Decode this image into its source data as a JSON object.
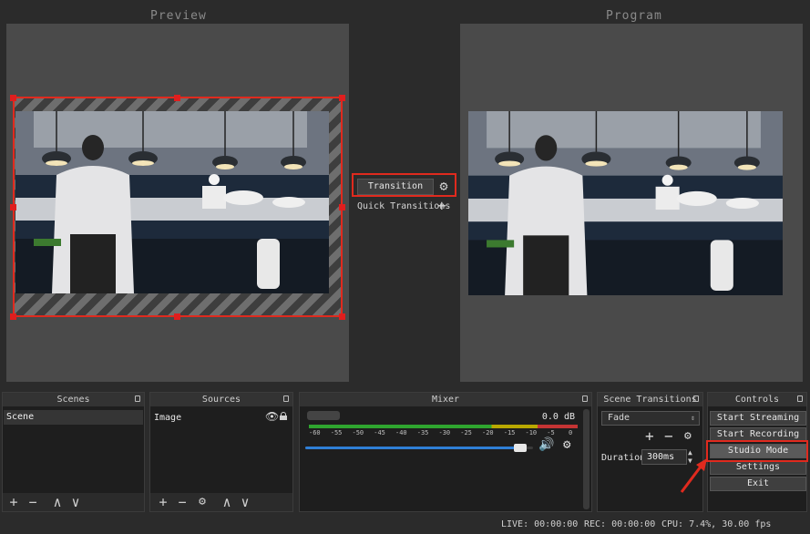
{
  "preview": {
    "title": "Preview"
  },
  "program": {
    "title": "Program"
  },
  "transition": {
    "button_label": "Transition",
    "quick_label": "Quick Transitions",
    "settings_icon": "gear-icon",
    "add_icon": "plus-icon"
  },
  "docks": {
    "scenes": {
      "title": "Scenes",
      "items": [
        "Scene"
      ]
    },
    "sources": {
      "title": "Sources",
      "items": [
        "Image"
      ]
    },
    "mixer": {
      "title": "Mixer",
      "db_value": "0.0 dB",
      "ticks": [
        "-60",
        "-55",
        "-50",
        "-45",
        "-40",
        "-35",
        "-30",
        "-25",
        "-20",
        "-15",
        "-10",
        "-5",
        "0"
      ],
      "volume_fraction": 0.97
    },
    "scene_transitions": {
      "title": "Scene Transitions",
      "selected": "Fade",
      "duration_label": "Duration",
      "duration_value": "300ms"
    },
    "controls": {
      "title": "Controls",
      "buttons": [
        "Start Streaming",
        "Start Recording",
        "Studio Mode",
        "Settings",
        "Exit"
      ]
    }
  },
  "status": {
    "live": "LIVE: 00:00:00",
    "rec": "REC: 00:00:00",
    "cpu": "CPU: 7.4%, 30.00 fps"
  },
  "colors": {
    "highlight_red": "#e02a1e",
    "accent_blue": "#2f7fd6",
    "meter_green": "#2fa52f",
    "meter_yellow": "#b9a800",
    "meter_red": "#c43434"
  }
}
